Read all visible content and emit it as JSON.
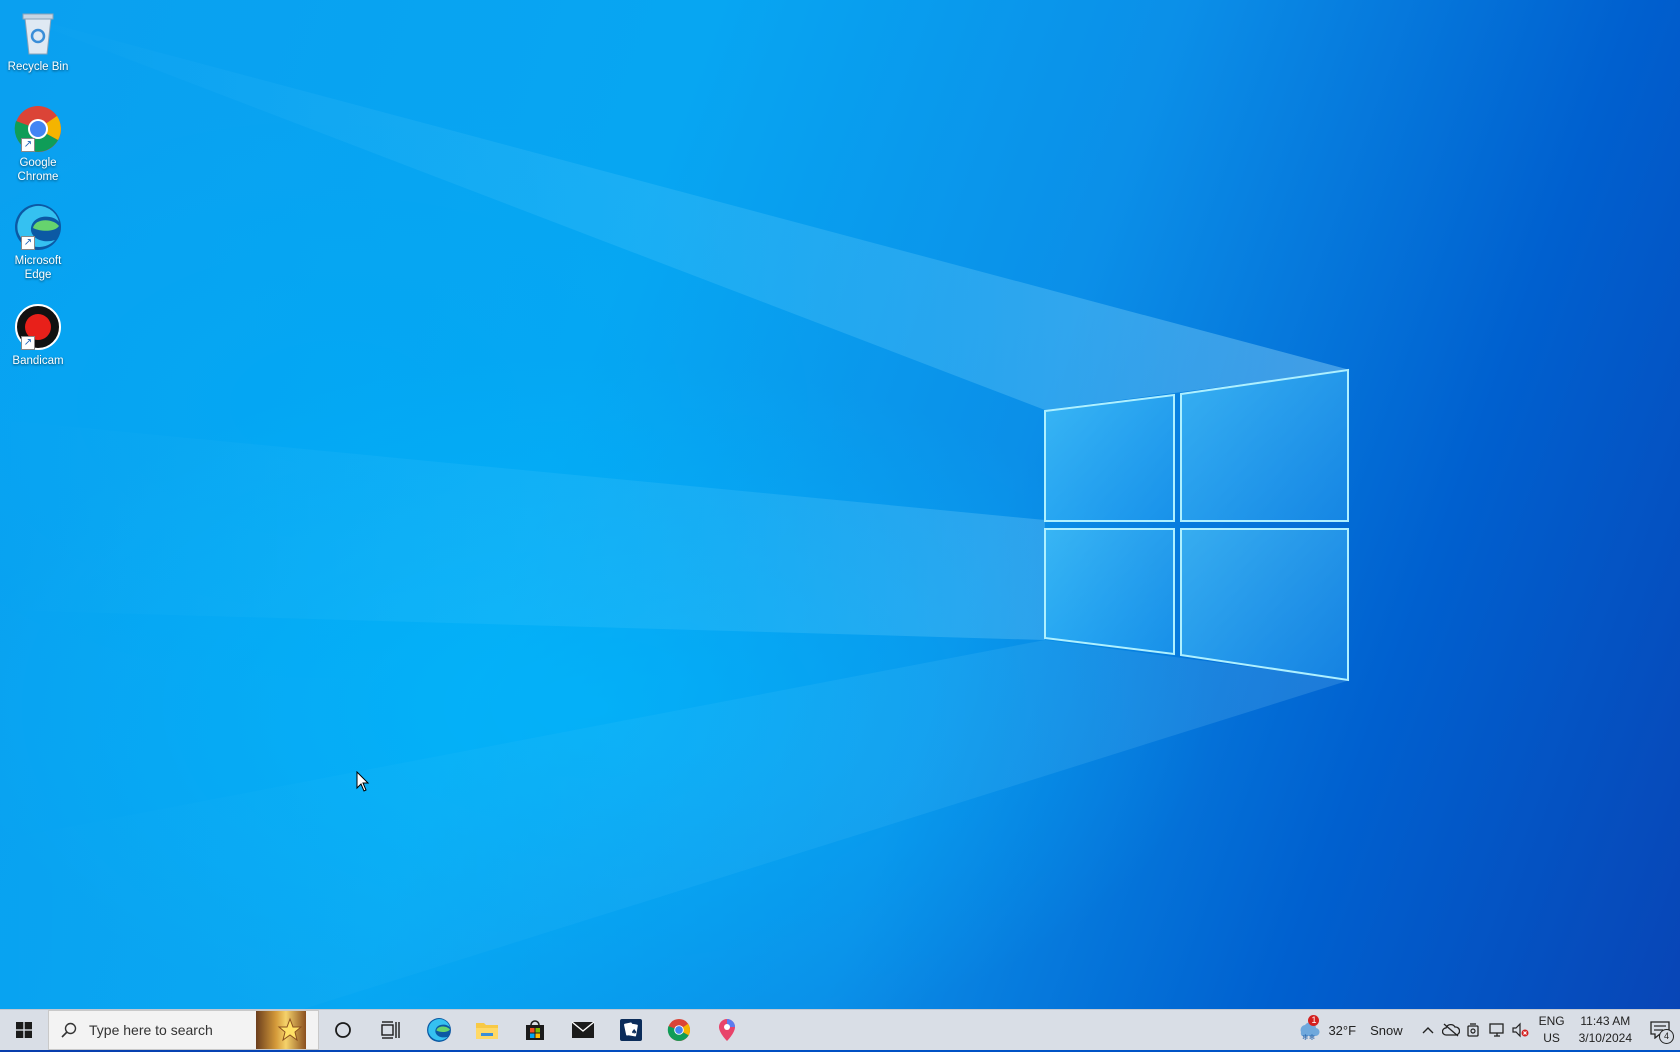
{
  "desktop": {
    "icons": [
      {
        "label": "Recycle Bin",
        "icon": "recycle-bin-icon"
      },
      {
        "label": "Google Chrome",
        "icon": "chrome-icon"
      },
      {
        "label": "Microsoft Edge",
        "icon": "edge-icon"
      },
      {
        "label": "Bandicam",
        "icon": "bandicam-icon"
      }
    ]
  },
  "taskbar": {
    "search_placeholder": "Type here to search",
    "pinned": [
      {
        "name": "cortana",
        "icon": "cortana-icon"
      },
      {
        "name": "task-view",
        "icon": "task-view-icon"
      },
      {
        "name": "edge",
        "icon": "edge-icon"
      },
      {
        "name": "file-explorer",
        "icon": "folder-icon"
      },
      {
        "name": "microsoft-store",
        "icon": "store-icon"
      },
      {
        "name": "mail",
        "icon": "mail-icon"
      },
      {
        "name": "solitaire",
        "icon": "solitaire-icon"
      },
      {
        "name": "chrome",
        "icon": "chrome-icon"
      },
      {
        "name": "maps",
        "icon": "maps-icon"
      }
    ],
    "weather": {
      "temp": "32°F",
      "condition": "Snow",
      "badge": "1"
    },
    "language": {
      "line1": "ENG",
      "line2": "US"
    },
    "clock": {
      "time": "11:43 AM",
      "date": "3/10/2024"
    },
    "notifications": {
      "count": "4"
    }
  },
  "colors": {
    "accent": "#0078d7",
    "taskbar": "#d9dee6"
  }
}
